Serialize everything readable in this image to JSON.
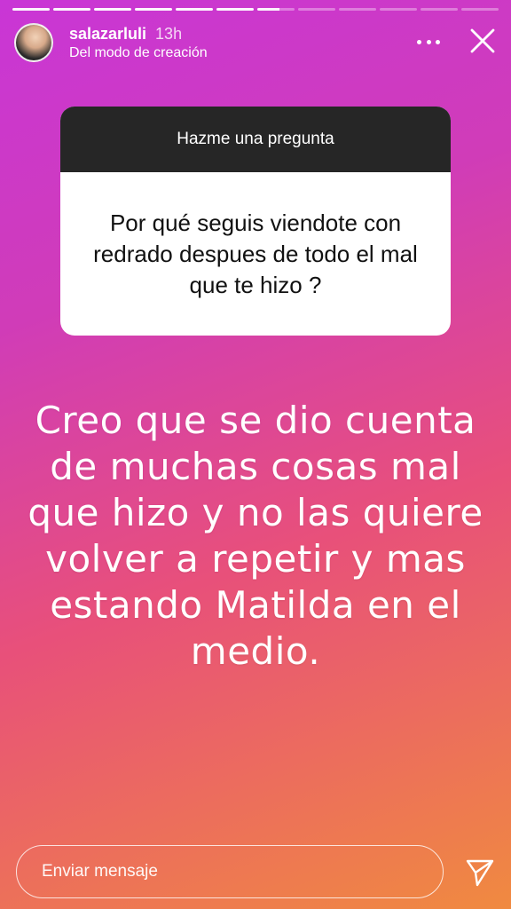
{
  "story": {
    "segments_total": 12,
    "segments_done": 6,
    "current_segment_progress": 0.6
  },
  "header": {
    "username": "salazarluli",
    "time": "13h",
    "subtitle": "Del modo de creación",
    "avatar_icon": "profile-avatar",
    "more_icon": "more-horizontal-icon",
    "close_icon": "close-icon"
  },
  "question": {
    "header": "Hazme una pregunta",
    "text": "Por qué seguis viendote con redrado despues de todo el mal que te hizo ?"
  },
  "answer": {
    "text": "Creo que se dio cuenta de muchas cosas mal que hizo y no las quiere volver a repetir y mas estando Matilda en el medio."
  },
  "footer": {
    "placeholder": "Enviar mensaje",
    "send_icon": "send-icon"
  },
  "colors": {
    "gradient_start": "#c936d6",
    "gradient_mid": "#e8507a",
    "gradient_end": "#f08a40",
    "card_header": "#262626"
  }
}
